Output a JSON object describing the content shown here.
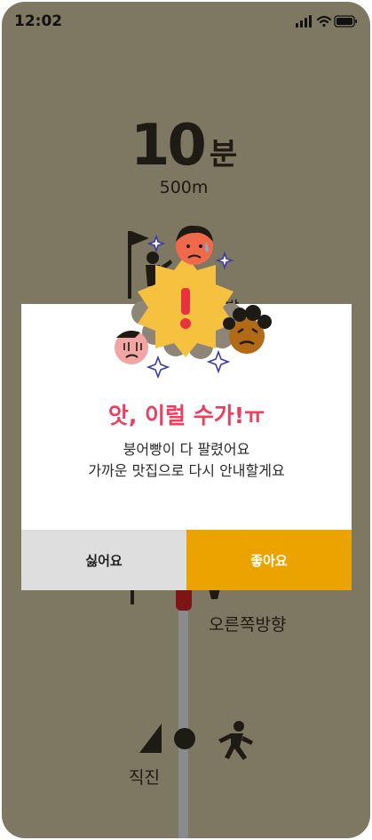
{
  "status_bar": {
    "time": "12:02",
    "icons": [
      "signal-icon",
      "wifi-icon",
      "battery-icon"
    ]
  },
  "navigation": {
    "distance_value": "10",
    "distance_unit": "분",
    "distance_meters": "500m",
    "arrival_partial": "발",
    "turn_label": "오른쪽방향",
    "straight_label": "직진"
  },
  "dialog": {
    "title": "앗, 이럴 수가!ㅠ",
    "message_line1": "붕어빵이 다 팔렸어요",
    "message_line2": "가까운 맛집으로 다시 안내할게요",
    "cancel_label": "싫어요",
    "confirm_label": "좋아요"
  },
  "colors": {
    "background": "#7e7863",
    "dialog_title": "#ef3d5e",
    "confirm_button": "#eba300",
    "cancel_button": "#dedede"
  }
}
